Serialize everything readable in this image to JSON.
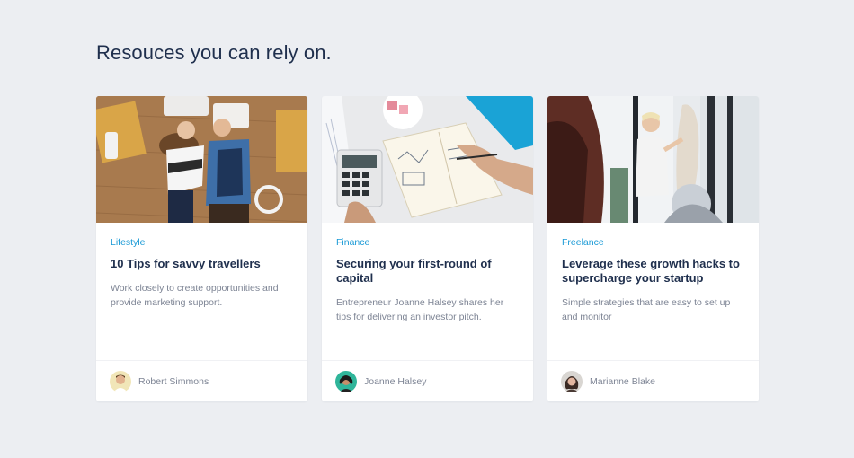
{
  "page": {
    "title": "Resouces you can rely on."
  },
  "cards": [
    {
      "image_alt": "Couple lying on a wooden floor among moving boxes",
      "category": "Lifestyle",
      "title": "10 Tips for savvy travellers",
      "description": "Work closely to create opportunities and provide marketing support.",
      "author": "Robert Simmons"
    },
    {
      "image_alt": "Hands with calculator and notebook on a marble desk",
      "category": "Finance",
      "title": "Securing your first-round of capital",
      "description": "Entrepreneur Joanne Halsey shares her tips for delivering an investor pitch.",
      "author": "Joanne Halsey"
    },
    {
      "image_alt": "Woman working on a dress form mannequin by a window",
      "category": "Freelance",
      "title": "Leverage these growth hacks to supercharge your startup",
      "description": "Simple strategies that are easy to set up and monitor",
      "author": "Marianne Blake"
    }
  ],
  "colors": {
    "background": "#eceef2",
    "heading": "#1f2f4d",
    "accent": "#1a9ad6",
    "muted": "#7d8494"
  }
}
